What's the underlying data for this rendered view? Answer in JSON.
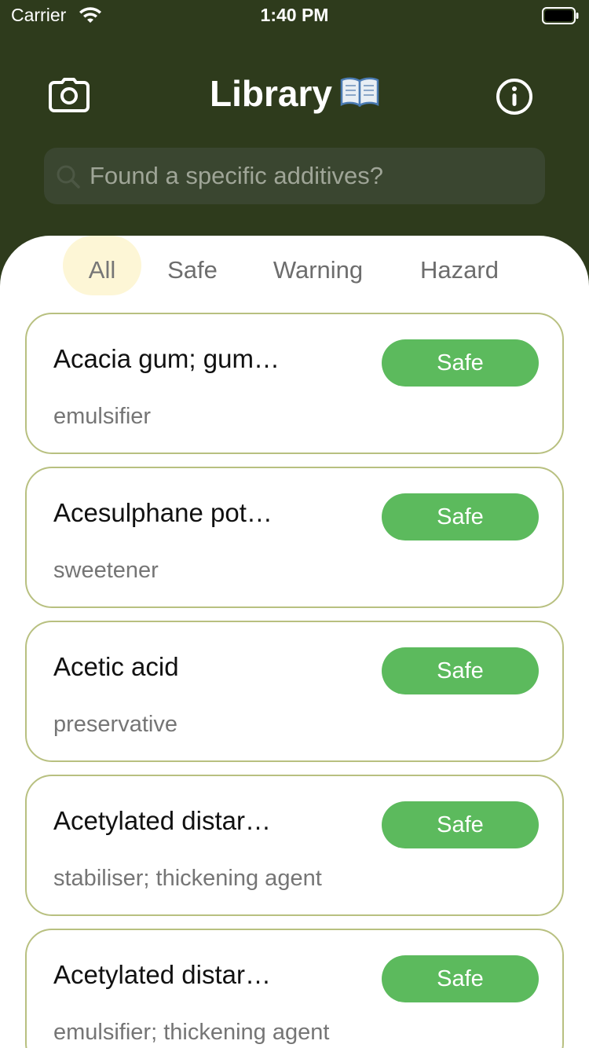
{
  "status_bar": {
    "carrier": "Carrier",
    "time": "1:40 PM"
  },
  "header": {
    "title": "Library",
    "title_icon": "open-book-icon",
    "left_icon": "camera-icon",
    "right_icon": "info-icon"
  },
  "search": {
    "placeholder": "Found a specific additives?",
    "value": ""
  },
  "tabs": [
    {
      "label": "All",
      "active": true
    },
    {
      "label": "Safe",
      "active": false
    },
    {
      "label": "Warning",
      "active": false
    },
    {
      "label": "Hazard",
      "active": false
    }
  ],
  "items": [
    {
      "name": "Acacia gum; gum…",
      "category": "emulsifier",
      "status": "Safe"
    },
    {
      "name": "Acesulphane pot…",
      "category": "sweetener",
      "status": "Safe"
    },
    {
      "name": "Acetic acid",
      "category": "preservative",
      "status": "Safe"
    },
    {
      "name": "Acetylated distar…",
      "category": "stabiliser; thickening agent",
      "status": "Safe"
    },
    {
      "name": "Acetylated distar…",
      "category": "emulsifier; thickening agent",
      "status": "Safe"
    }
  ],
  "colors": {
    "header_bg": "#2e3b1c",
    "search_bg": "#3a4630",
    "active_tab_bg": "#fdf6d6",
    "card_border": "#b8c080",
    "safe_badge": "#5cba5d"
  }
}
